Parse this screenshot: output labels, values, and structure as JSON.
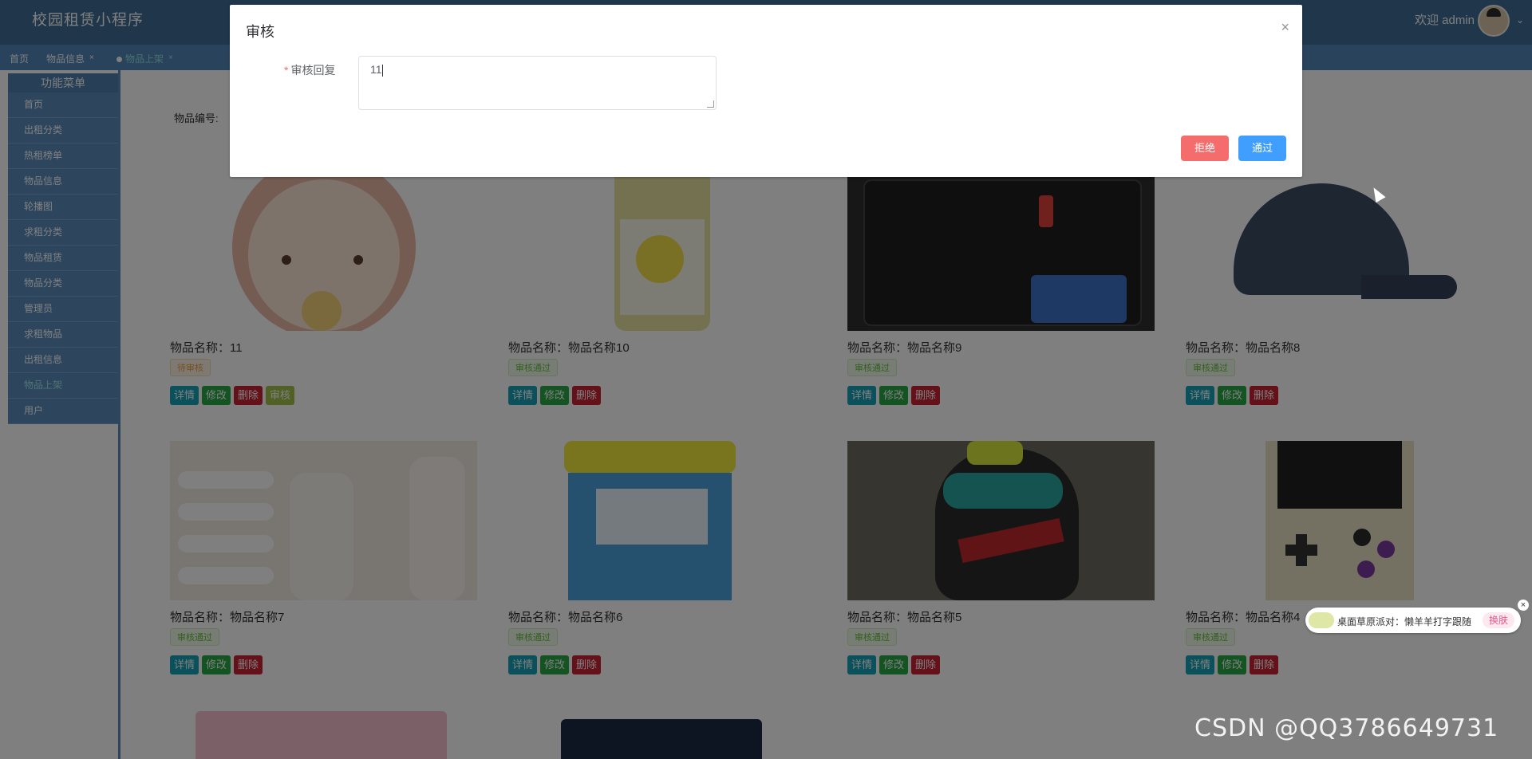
{
  "header": {
    "app_title": "校园租赁小程序",
    "welcome": "欢迎 admin"
  },
  "tabs": [
    {
      "label": "首页"
    },
    {
      "label": "物品信息"
    },
    {
      "label": "物品上架"
    }
  ],
  "sidebar": {
    "title": "功能菜单",
    "items": [
      {
        "label": "首页"
      },
      {
        "label": "出租分类"
      },
      {
        "label": "热租榜单"
      },
      {
        "label": "物品信息"
      },
      {
        "label": "轮播图"
      },
      {
        "label": "求租分类"
      },
      {
        "label": "物品租赁"
      },
      {
        "label": "物品分类"
      },
      {
        "label": "管理员"
      },
      {
        "label": "求租物品"
      },
      {
        "label": "出租信息"
      },
      {
        "label": "物品上架"
      },
      {
        "label": "用户"
      }
    ]
  },
  "filter": {
    "label": "物品编号:"
  },
  "items": [
    {
      "name": "物品名称：11",
      "status": "待审核",
      "thumb_color": "#f6d9c9"
    },
    {
      "name": "物品名称：物品名称10",
      "status": "审核通过",
      "thumb_color": "#f4eb8c"
    },
    {
      "name": "物品名称：物品名称9",
      "status": "审核通过",
      "thumb_color": "#3b3b3b"
    },
    {
      "name": "物品名称：物品名称8",
      "status": "审核通过",
      "thumb_color": "#d8dce0"
    },
    {
      "name": "物品名称：物品名称7",
      "status": "审核通过",
      "thumb_color": "#efe3d7"
    },
    {
      "name": "物品名称：物品名称6",
      "status": "审核通过",
      "thumb_color": "#8ccbe8"
    },
    {
      "name": "物品名称：物品名称5",
      "status": "审核通过",
      "thumb_color": "#5a5a56"
    },
    {
      "name": "物品名称：物品名称4",
      "status": "审核通过",
      "thumb_color": "#e4dcc4"
    }
  ],
  "buttons": {
    "detail": "详情",
    "edit": "修改",
    "delete": "删除",
    "audit": "审核"
  },
  "dialog": {
    "title": "审核",
    "close_icon": "×",
    "reply_label": "审核回复",
    "required_mark": "*",
    "reply_value": "11",
    "reject": "拒绝",
    "pass": "通过"
  },
  "widget": {
    "text": "桌面草原派对：懒羊羊打字跟随",
    "button": "换肤"
  },
  "watermark": "CSDN @QQ3786649731"
}
